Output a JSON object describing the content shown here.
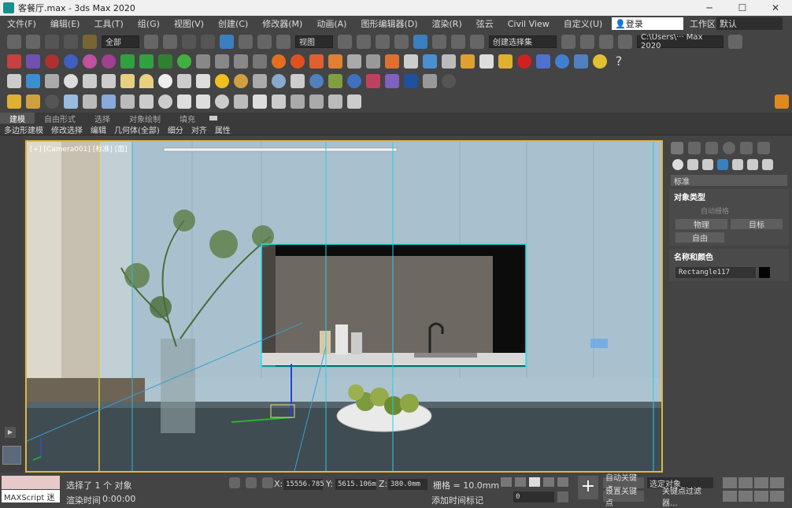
{
  "window": {
    "title": "客餐厅.max - 3ds Max 2020",
    "min": "─",
    "max": "☐",
    "close": "✕"
  },
  "menu": {
    "items": [
      "文件(F)",
      "编辑(E)",
      "工具(T)",
      "组(G)",
      "视图(V)",
      "创建(C)",
      "修改器(M)",
      "动画(A)",
      "图形编辑器(D)",
      "渲染(R)",
      "弦云",
      "Civil View",
      "自定义(U)"
    ],
    "login": "登录",
    "workspace_label": "工作区:",
    "workspace": "默认"
  },
  "toolbar": {
    "selection_filter": "全部",
    "ref_coord": "视图",
    "named_selection": "创建选择集",
    "path": "C:\\Users\\··· Max 2020"
  },
  "ribbon": {
    "tabs": [
      "建模",
      "自由形式",
      "选择",
      "对象绘制",
      "填充"
    ],
    "active": "建模",
    "sub": [
      "多边形建模",
      "修改选择",
      "编辑",
      "几何体(全部)",
      "细分",
      "对齐",
      "属性"
    ]
  },
  "viewport": {
    "label": "[+] [Camera001] [标准] [面]"
  },
  "command_panel": {
    "category": "标准",
    "object_type_title": "对象类型",
    "auto_grid": "自动栅格",
    "btn_physical": "物理",
    "btn_target": "目标",
    "btn_free": "自由",
    "name_color_title": "名称和颜色",
    "object_name": "Rectangle117",
    "object_color": "#050505"
  },
  "status": {
    "maxscript": "MAXScript 迷",
    "selected": "选择了 1 个 对象",
    "render_time_label": "渲染时间",
    "render_time": "0:00:00",
    "x_label": "X:",
    "x": "15556.785",
    "y_label": "Y:",
    "y": "5615.106m",
    "z_label": "Z:",
    "z": "380.0mm",
    "grid": "栅格 = 10.0mm",
    "add_time_tag": "添加时间标记",
    "auto_key": "自动关键点",
    "set_key": "设置关键点",
    "selected_object": "选定对象",
    "key_filters": "关键点过滤器...",
    "frame": "0"
  }
}
